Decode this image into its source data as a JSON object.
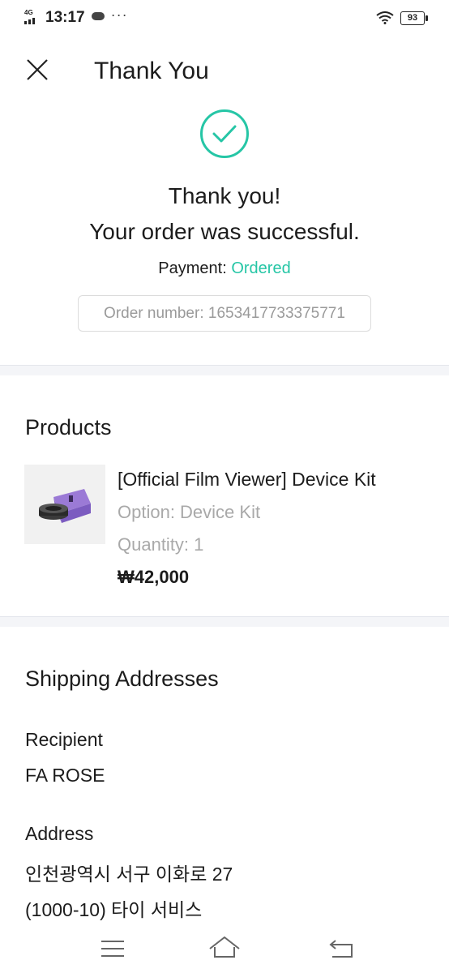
{
  "status_bar": {
    "network": "4G",
    "time": "13:17",
    "more": "···",
    "battery": "93"
  },
  "header": {
    "title": "Thank You",
    "close_icon": "close-icon"
  },
  "success": {
    "icon": "check-circle-icon",
    "line1": "Thank you!",
    "line2": "Your order was successful.",
    "payment_label": "Payment: ",
    "payment_status": "Ordered",
    "order_number": "Order number: 1653417733375771"
  },
  "products": {
    "title": "Products",
    "items": [
      {
        "name": "[Official Film Viewer] Device Kit",
        "option": "Option: Device Kit",
        "quantity": "Quantity: 1",
        "price": "₩42,000"
      }
    ]
  },
  "shipping": {
    "title": "Shipping Addresses",
    "recipient_label": "Recipient",
    "recipient": "FA ROSE",
    "address_label": "Address",
    "address_line1": "인천광역시 서구 이화로 27",
    "address_line2": "(1000-10) 타이 서비스"
  },
  "nav": {
    "menu": "menu-icon",
    "home": "home-icon",
    "back": "back-icon"
  },
  "colors": {
    "accent": "#26c6a6",
    "muted": "#a9a9a9",
    "divider": "#f4f5f8"
  }
}
